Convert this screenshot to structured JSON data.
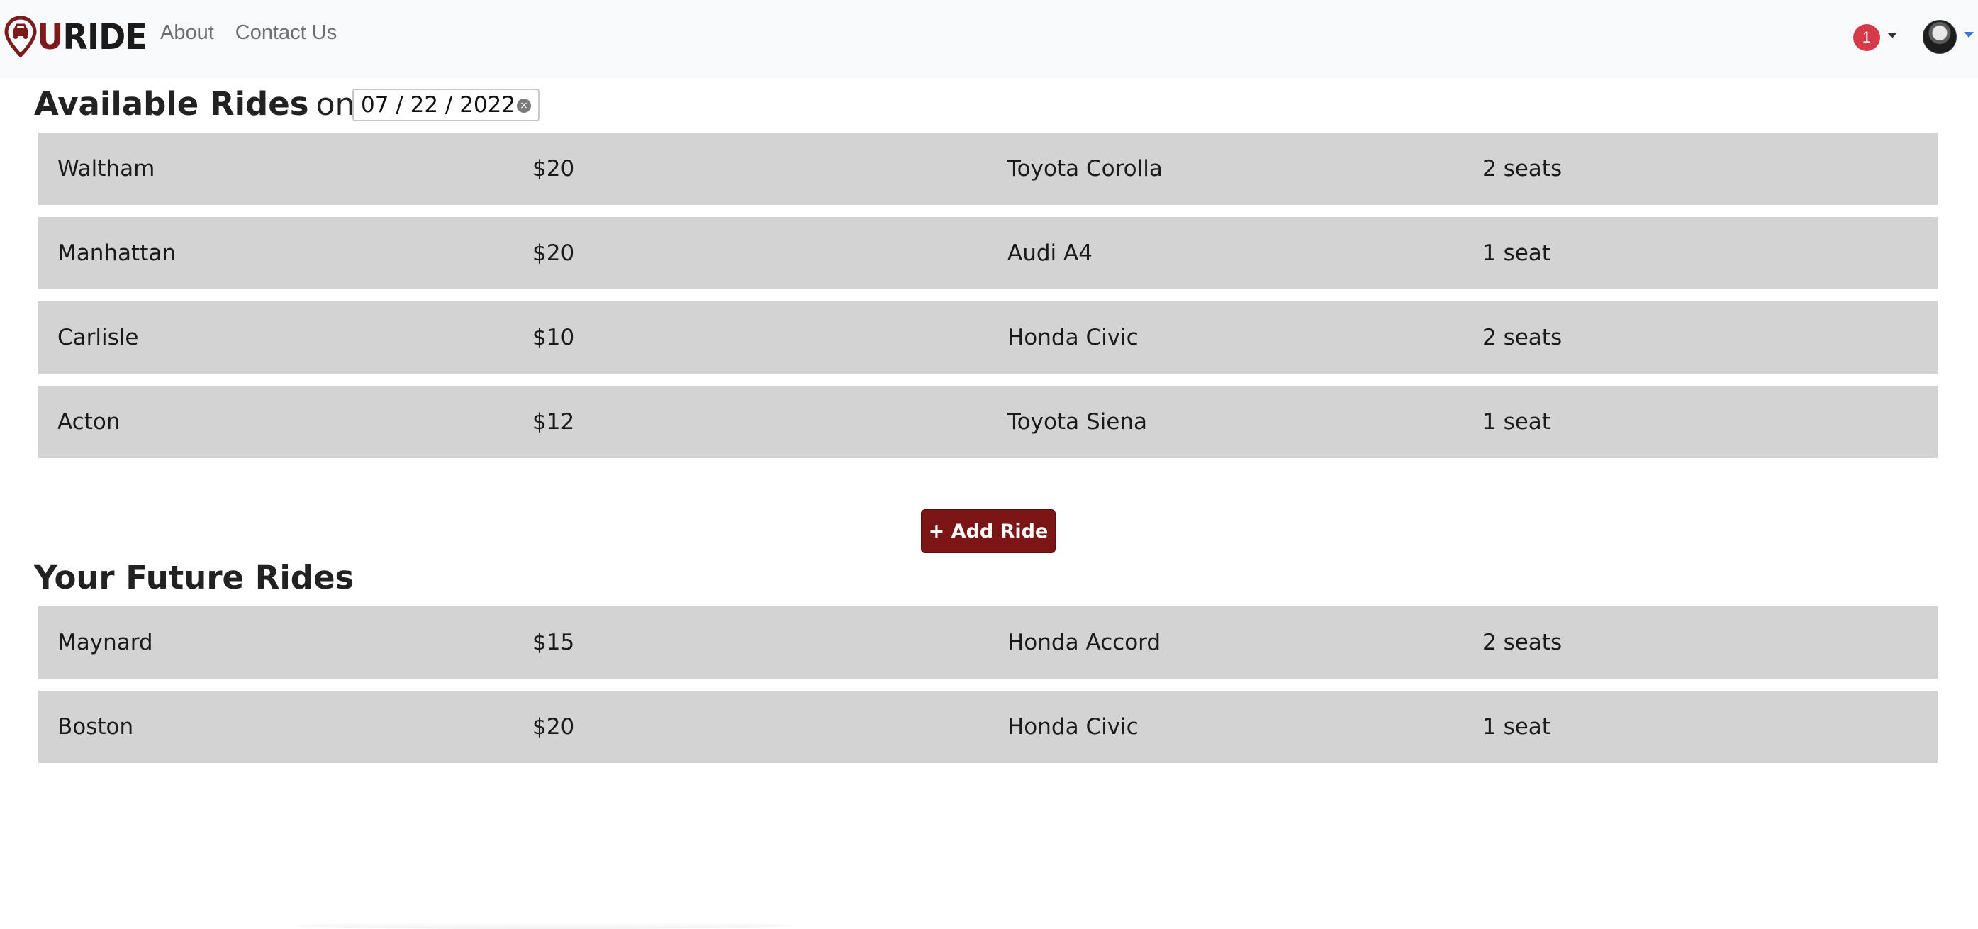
{
  "brand": {
    "letter": "U",
    "name": "RIDE",
    "accent_color": "#7b1b1b"
  },
  "nav": {
    "links": [
      {
        "label": "About"
      },
      {
        "label": "Contact Us"
      }
    ]
  },
  "header_right": {
    "notification_count": "1",
    "notification_icon": "bell-dropdown",
    "profile_icon": "user-avatar"
  },
  "available": {
    "title": "Available Rides",
    "on_label": "on",
    "date": "07 / 22 / 2022",
    "rides": [
      {
        "location": "Waltham",
        "price": "$20",
        "car": "Toyota Corolla",
        "seats": "2 seats"
      },
      {
        "location": "Manhattan",
        "price": "$20",
        "car": "Audi A4",
        "seats": "1 seat"
      },
      {
        "location": "Carlisle",
        "price": "$10",
        "car": "Honda Civic",
        "seats": "2 seats"
      },
      {
        "location": "Acton",
        "price": "$12",
        "car": "Toyota Siena",
        "seats": "1 seat"
      }
    ]
  },
  "add_button": {
    "label": "+ Add Ride",
    "color": "#7b1414"
  },
  "future": {
    "title": "Your Future Rides",
    "rides": [
      {
        "location": "Maynard",
        "price": "$15",
        "car": "Honda Accord",
        "seats": "2 seats"
      },
      {
        "location": "Boston",
        "price": "$20",
        "car": "Honda Civic",
        "seats": "1 seat"
      }
    ]
  },
  "colors": {
    "row_background": "#d3d3d3",
    "badge": "#d63a48",
    "navbar": "#f8f9fa"
  }
}
